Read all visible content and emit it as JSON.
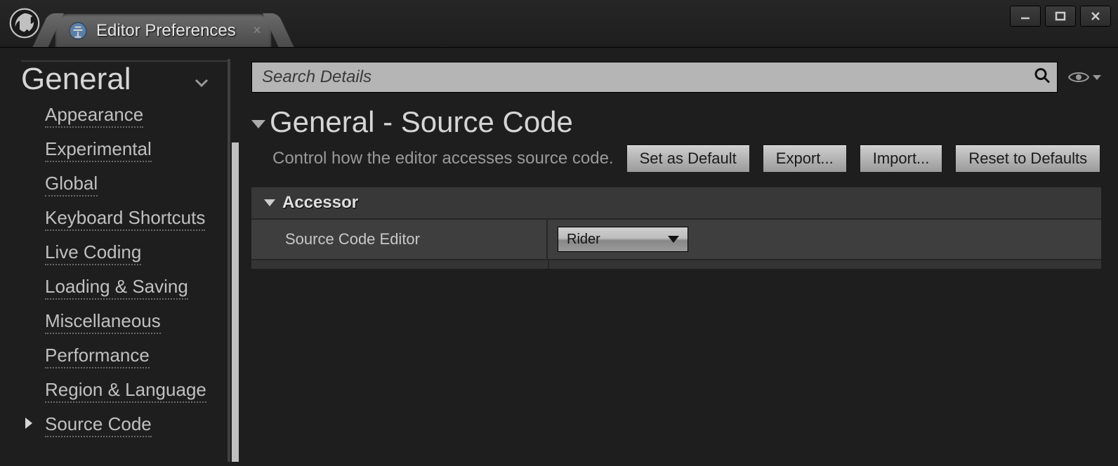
{
  "tab": {
    "title": "Editor Preferences"
  },
  "sidebar": {
    "heading": "General",
    "items": [
      {
        "label": "Appearance",
        "selected": false
      },
      {
        "label": "Experimental",
        "selected": false
      },
      {
        "label": "Global",
        "selected": false
      },
      {
        "label": "Keyboard Shortcuts",
        "selected": false
      },
      {
        "label": "Live Coding",
        "selected": false
      },
      {
        "label": "Loading & Saving",
        "selected": false
      },
      {
        "label": "Miscellaneous",
        "selected": false
      },
      {
        "label": "Performance",
        "selected": false
      },
      {
        "label": "Region & Language",
        "selected": false
      },
      {
        "label": "Source Code",
        "selected": true
      }
    ]
  },
  "search": {
    "placeholder": "Search Details"
  },
  "page": {
    "title": "General - Source Code",
    "description": "Control how the editor accesses source code.",
    "buttons": {
      "setDefault": "Set as Default",
      "export": "Export...",
      "import": "Import...",
      "reset": "Reset to Defaults"
    }
  },
  "section": {
    "title": "Accessor",
    "row": {
      "label": "Source Code Editor",
      "value": "Rider"
    }
  }
}
